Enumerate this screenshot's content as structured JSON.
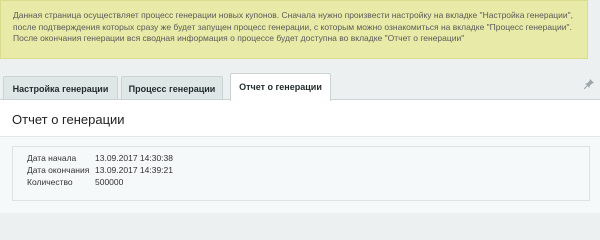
{
  "notice": {
    "text": "Данная страница осуществляет процесс генерации новых купонов. Сначала нужно произвести настройку на вкладке \"Настройка генерации\", после подтверждения которых сразу же будет запущен процесс генерации, с которым можно ознакомиться на вкладке \"Процесс генерации\". После окончания генерации вся сводная информация о процессе будет доступна во вкладке \"Отчет о генерации\""
  },
  "tabs": [
    {
      "label": "Настройка генерации"
    },
    {
      "label": "Процесс генерации"
    },
    {
      "label": "Отчет о генерации"
    }
  ],
  "panel": {
    "title": "Отчет о генерации",
    "rows": [
      {
        "key": "Дата начала",
        "value": "13.09.2017 14:30:38"
      },
      {
        "key": "Дата окончания",
        "value": "13.09.2017 14:39:21"
      },
      {
        "key": "Количество",
        "value": "500000"
      }
    ]
  },
  "icons": {
    "pin": "pin-icon"
  }
}
